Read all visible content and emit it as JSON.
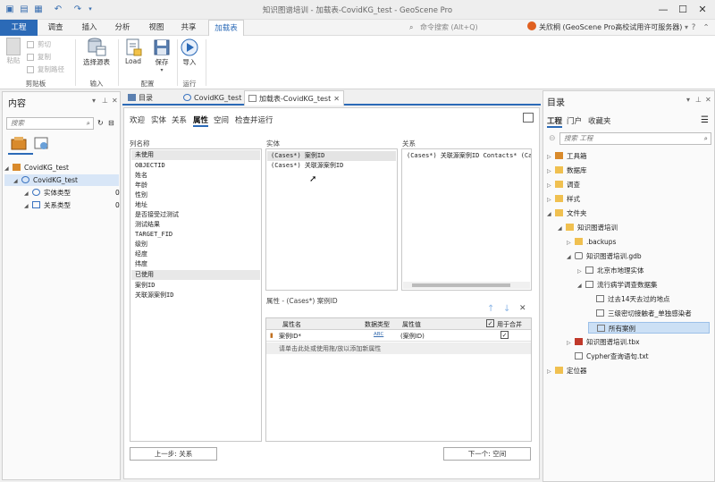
{
  "titlebar": {
    "title": "知识图谱培训 - 加载表-CovidKG_test - GeoScene Pro"
  },
  "ribbon_tabs": {
    "file": "工程",
    "tabs": [
      "调查",
      "插入",
      "分析",
      "视图",
      "共享"
    ],
    "active": "加载表",
    "search_placeholder": "命令搜索 (Alt+Q)",
    "user": "关欣桐 (GeoScene Pro高校试用许可服务器)"
  },
  "ribbon": {
    "clipboard": {
      "paste": "粘贴",
      "cut": "剪切",
      "copy": "复制",
      "copy_path": "复制路径",
      "group": "剪贴板"
    },
    "input": {
      "select_source": "选择源表",
      "group": "输入"
    },
    "config": {
      "load": "Load",
      "save": "保存",
      "group": "配置"
    },
    "run": {
      "import": "导入",
      "group": "运行"
    }
  },
  "contents": {
    "title": "内容",
    "search_placeholder": "搜索",
    "tree": [
      {
        "label": "CovidKG_test",
        "level": 0
      },
      {
        "label": "CovidKG_test",
        "level": 1
      },
      {
        "label": "实体类型",
        "count": "0",
        "level": 2
      },
      {
        "label": "关系类型",
        "count": "0",
        "level": 2
      }
    ]
  },
  "doc_tabs": [
    {
      "label": "目录"
    },
    {
      "label": "CovidKG_test"
    },
    {
      "label": "加载表-CovidKG_test",
      "active": true
    }
  ],
  "main": {
    "subtabs": [
      "欢迎",
      "实体",
      "关系",
      "属性",
      "空间",
      "检查并运行"
    ],
    "active_subtab": "属性",
    "column_names_label": "列名称",
    "unused_header": "未使用",
    "unused_columns": [
      "OBJECTID",
      "姓名",
      "年龄",
      "性别",
      "地址",
      "是否接受过测试",
      "测试结果",
      "TARGET_FID",
      "级别",
      "经度",
      "纬度"
    ],
    "used_header": "已使用",
    "used_columns": [
      "案例ID",
      "关联源案例ID"
    ],
    "entity_label": "实体",
    "entity_items": [
      "(Cases*) 案例ID",
      "(Cases*) 关联源案例ID"
    ],
    "relation_label": "关系",
    "relation_items": [
      "(Cases*) 关联源案例ID Contacts* (Ca"
    ],
    "properties_title": "属性 - (Cases*) 案例ID",
    "grid_headers": [
      "属性名",
      "数据类型",
      "属性值",
      "用于合并"
    ],
    "grid_rows": [
      {
        "name": "案例ID*",
        "type": "ABC",
        "value": "(案例ID)",
        "merge": "✓"
      }
    ],
    "grid_hint": "请单击此处或使用拖/放以添加新属性",
    "prev_button": "上一步: 关系",
    "next_button": "下一个: 空间"
  },
  "catalog": {
    "title": "目录",
    "tabs": [
      "工程",
      "门户",
      "收藏夹"
    ],
    "active_tab": "工程",
    "search_placeholder": "搜索 工程",
    "tree": [
      {
        "label": "工具箱",
        "level": 0
      },
      {
        "label": "数据库",
        "level": 0
      },
      {
        "label": "调查",
        "level": 0
      },
      {
        "label": "样式",
        "level": 0
      },
      {
        "label": "文件夹",
        "level": 0
      },
      {
        "label": "知识图谱培训",
        "level": 1
      },
      {
        "label": ".backups",
        "level": 2
      },
      {
        "label": "知识图谱培训.gdb",
        "level": 2
      },
      {
        "label": "北京市地理实体",
        "level": 3
      },
      {
        "label": "流行病学调查数据集",
        "level": 3
      },
      {
        "label": "过去14天去过的地点",
        "level": 4
      },
      {
        "label": "三级密切接触者_单独感染者",
        "level": 4
      },
      {
        "label": "所有案例",
        "level": 4
      },
      {
        "label": "知识图谱培训.tbx",
        "level": 2
      },
      {
        "label": "Cypher查询语句.txt",
        "level": 2
      },
      {
        "label": "定位器",
        "level": 0
      }
    ]
  },
  "colors": {
    "accent": "#2b6ab7",
    "selection": "#cce0f5"
  }
}
